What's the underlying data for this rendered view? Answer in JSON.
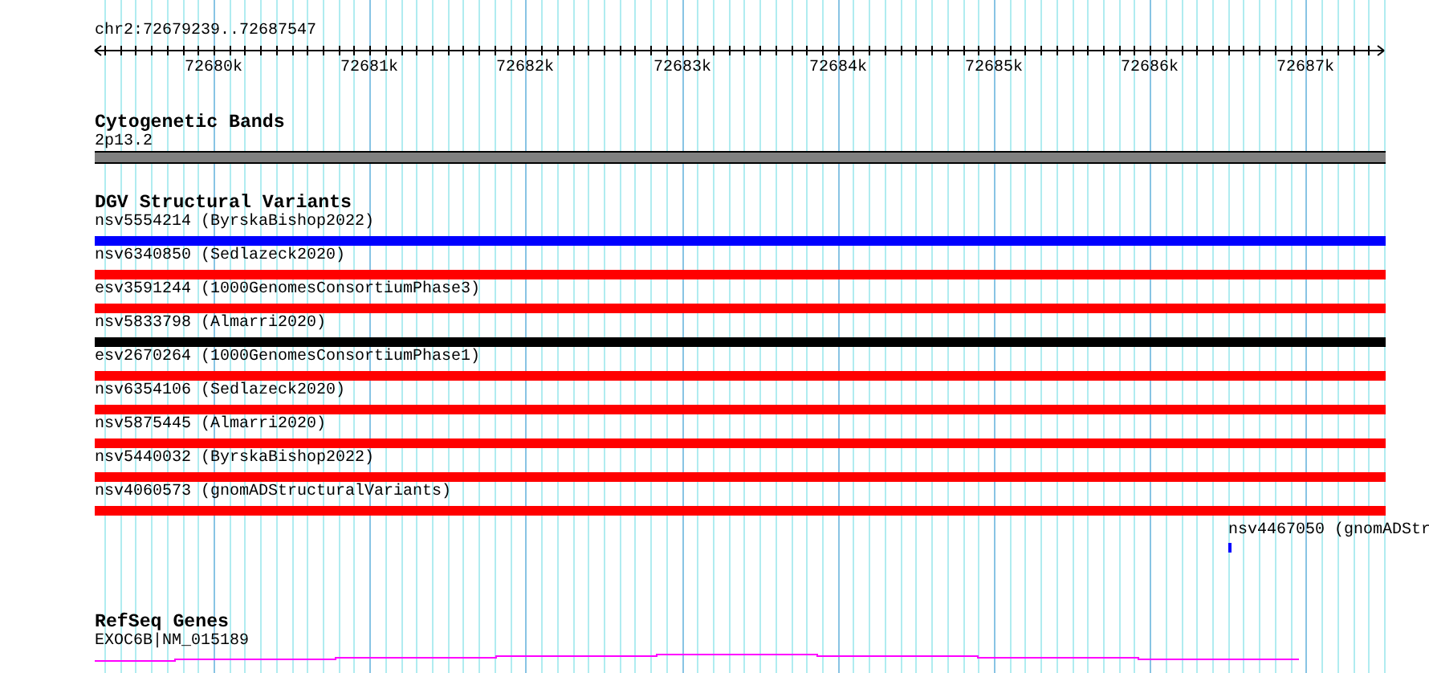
{
  "ruler": {
    "location": "chr2:72679239..72687547",
    "ticks": [
      "72680k",
      "72681k",
      "72682k",
      "72683k",
      "72684k",
      "72685k",
      "72686k",
      "72687k"
    ]
  },
  "cytoband_track": {
    "title": "Cytogenetic Bands",
    "band": {
      "label": "2p13.2",
      "color": "#808080"
    }
  },
  "dgv_track": {
    "title": "DGV Structural Variants",
    "features": [
      {
        "label": "nsv5554214 (ByrskaBishop2022)",
        "color": "#0000ff",
        "kind": "full"
      },
      {
        "label": "nsv6340850 (Sedlazeck2020)",
        "color": "#ff0000",
        "kind": "full"
      },
      {
        "label": "esv3591244 (1000GenomesConsortiumPhase3)",
        "color": "#ff0000",
        "kind": "full"
      },
      {
        "label": "nsv5833798 (Almarri2020)",
        "color": "#000000",
        "kind": "full"
      },
      {
        "label": "esv2670264 (1000GenomesConsortiumPhase1)",
        "color": "#ff0000",
        "kind": "full"
      },
      {
        "label": "nsv6354106 (Sedlazeck2020)",
        "color": "#ff0000",
        "kind": "full"
      },
      {
        "label": "nsv5875445 (Almarri2020)",
        "color": "#ff0000",
        "kind": "full"
      },
      {
        "label": "nsv5440032 (ByrskaBishop2022)",
        "color": "#ff0000",
        "kind": "full"
      },
      {
        "label": "nsv4060573 (gnomADStructuralVariants)",
        "color": "#ff0000",
        "kind": "full"
      },
      {
        "label": "nsv4467050 (gnomADStr",
        "color": "#0000ff",
        "kind": "small"
      }
    ]
  },
  "refseq_track": {
    "title": "RefSeq Genes",
    "gene": {
      "label": "EXOC6B|NM_015189",
      "color": "#ff00ff"
    }
  }
}
